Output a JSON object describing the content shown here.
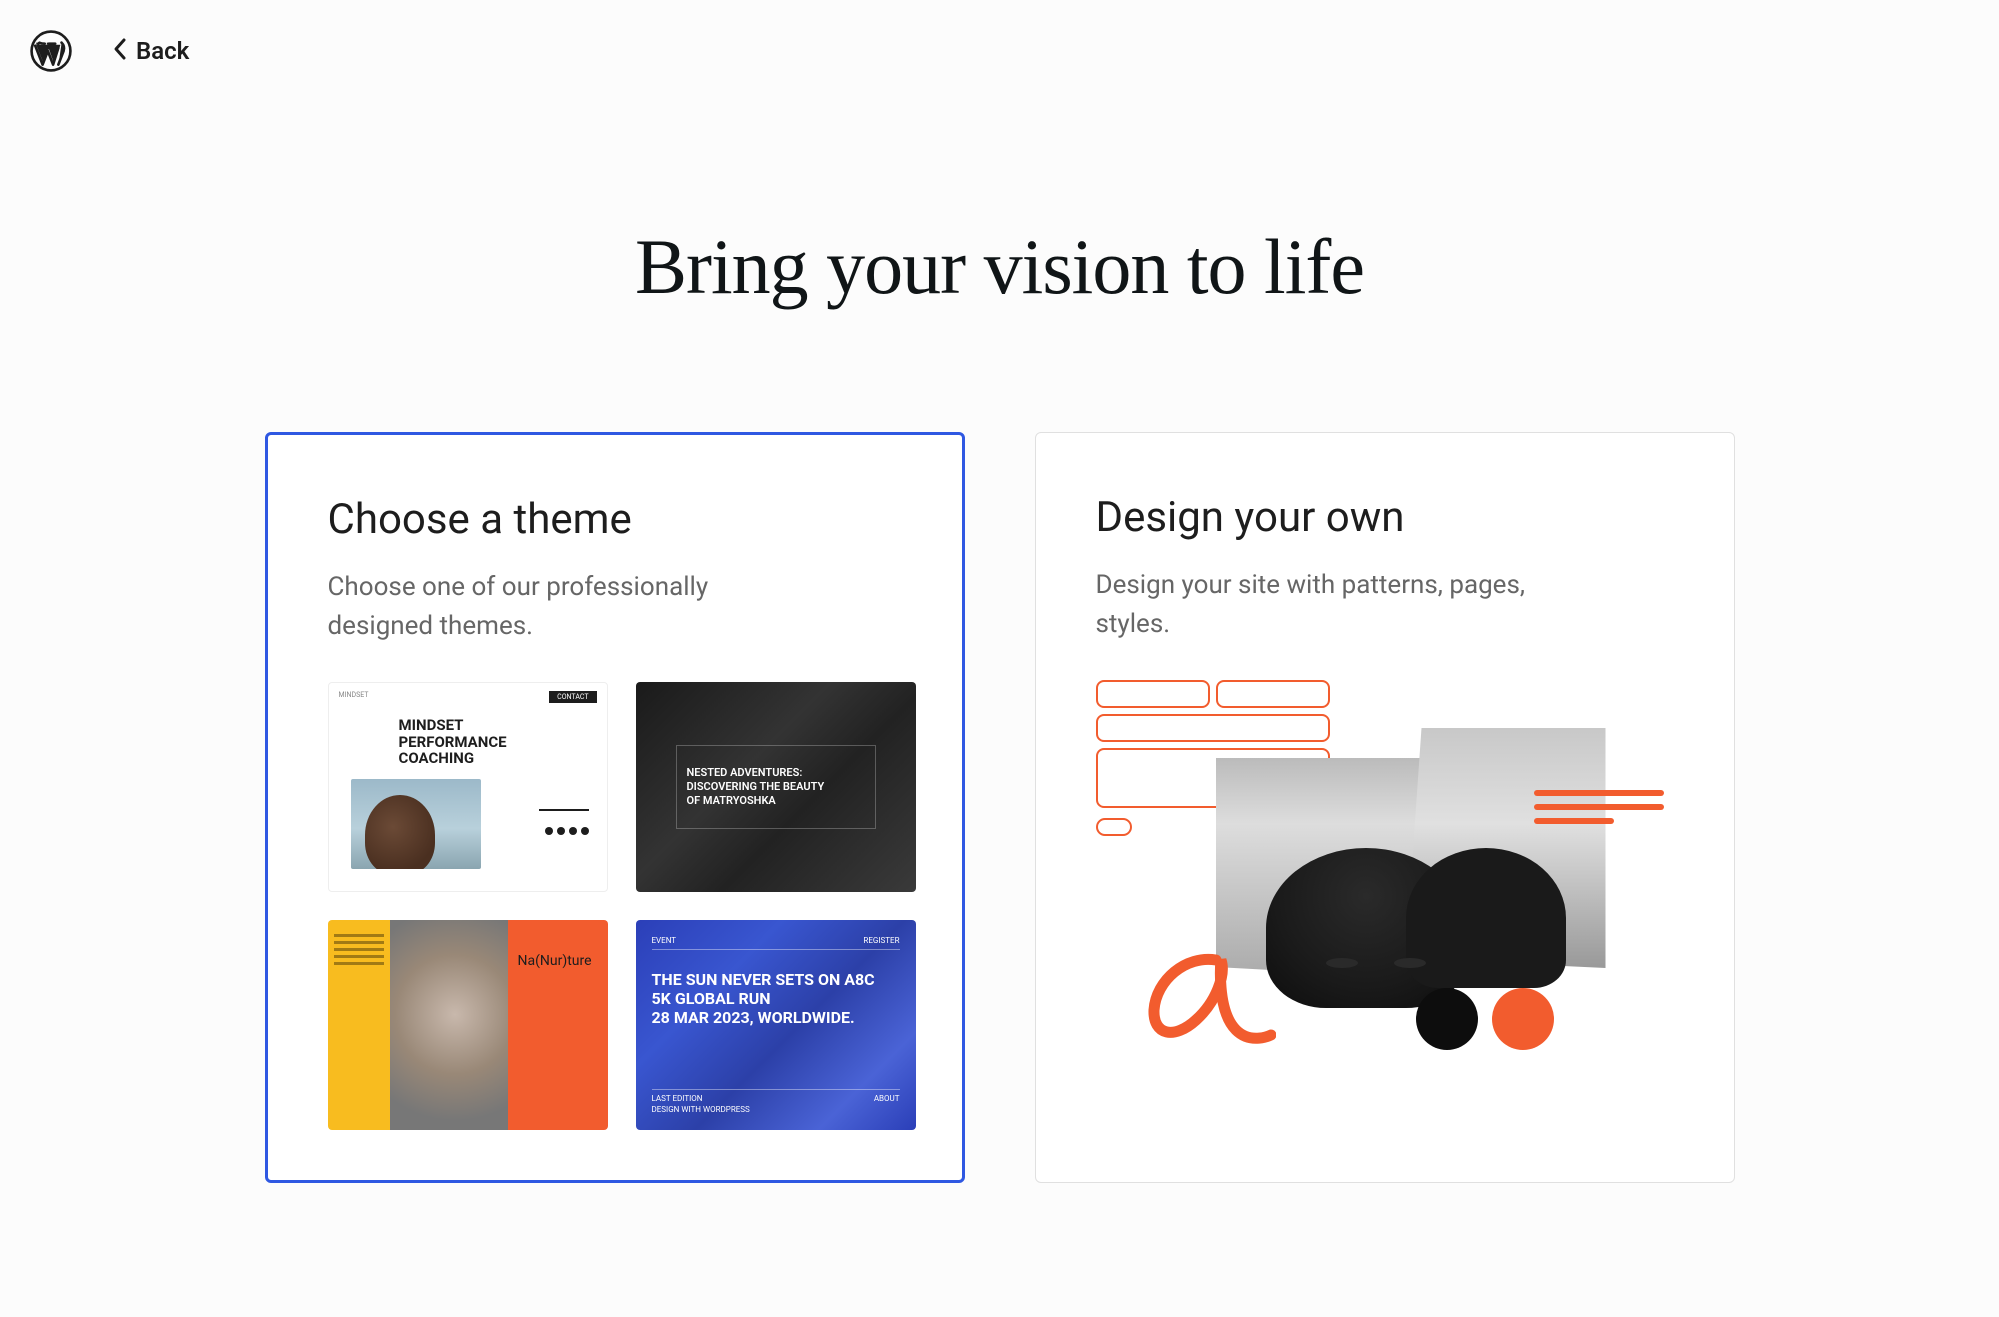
{
  "header": {
    "back_label": "Back"
  },
  "page": {
    "title": "Bring your vision to life"
  },
  "cards": {
    "theme": {
      "title": "Choose a theme",
      "description": "Choose one of our professionally designed themes.",
      "tiles": {
        "t1": {
          "nav_left": "MINDSET",
          "nav_btn": "CONTACT",
          "headline_l1": "MINDSET",
          "headline_l2": "PERFORMANCE",
          "headline_l3": "COACHING"
        },
        "t2": {
          "line1": "NESTED ADVENTURES:",
          "line2": "DISCOVERING THE BEAUTY",
          "line3": "OF MATRYOSHKA"
        },
        "t3": {
          "label": "Na(Nur)ture"
        },
        "t4": {
          "top_left": "EVENT",
          "top_right": "REGISTER",
          "main_l1": "THE SUN NEVER SETS ON A8C",
          "main_l2": "5K GLOBAL RUN",
          "main_l3": "28 MAR 2023, WORLDWIDE.",
          "bottom_left": "LAST EDITION",
          "bottom_left2": "DESIGN WITH WORDPRESS",
          "bottom_right": "ABOUT"
        }
      }
    },
    "design": {
      "title": "Design your own",
      "description": "Design your site with patterns, pages, styles."
    }
  }
}
